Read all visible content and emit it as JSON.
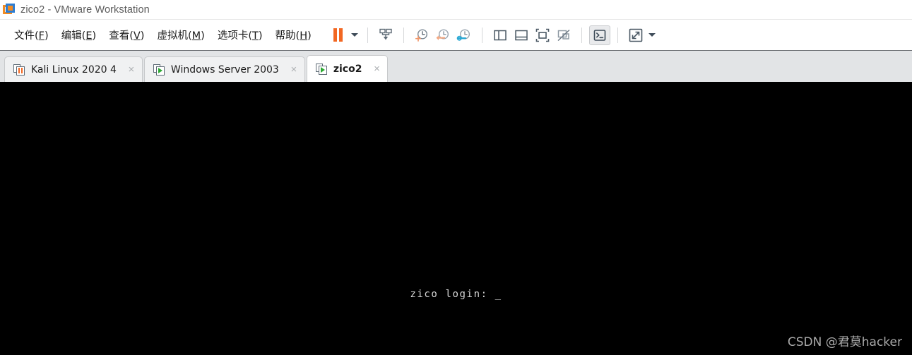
{
  "window": {
    "title": "zico2 - VMware Workstation",
    "logo_icon": "vmware-logo-icon"
  },
  "menubar": {
    "items": [
      {
        "label": "文件(F)",
        "name": "menu-file",
        "pre": "文件(",
        "key": "F",
        "post": ")"
      },
      {
        "label": "编辑(E)",
        "name": "menu-edit",
        "pre": "编辑(",
        "key": "E",
        "post": ")"
      },
      {
        "label": "查看(V)",
        "name": "menu-view",
        "pre": "查看(",
        "key": "V",
        "post": ")"
      },
      {
        "label": "虚拟机(M)",
        "name": "menu-vm",
        "pre": "虚拟机(",
        "key": "M",
        "post": ")"
      },
      {
        "label": "选项卡(T)",
        "name": "menu-tabs",
        "pre": "选项卡(",
        "key": "T",
        "post": ")"
      },
      {
        "label": "帮助(H)",
        "name": "menu-help",
        "pre": "帮助(",
        "key": "H",
        "post": ")"
      }
    ]
  },
  "toolbar": {
    "buttons": [
      {
        "name": "suspend-button",
        "icon": "pause-icon",
        "state": "normal"
      },
      {
        "name": "power-dropdown",
        "icon": "chevron-down-icon",
        "state": "normal"
      },
      {
        "name": "send-ctrl-alt-del-button",
        "icon": "snapshot-down-icon",
        "state": "normal"
      },
      {
        "name": "take-snapshot-button",
        "icon": "clock-plus-icon",
        "state": "normal"
      },
      {
        "name": "revert-snapshot-button",
        "icon": "clock-back-icon",
        "state": "normal"
      },
      {
        "name": "snapshot-manager-button",
        "icon": "clock-wrench-icon",
        "state": "normal"
      },
      {
        "name": "show-sidebar-button",
        "icon": "split-vertical-icon",
        "state": "normal"
      },
      {
        "name": "show-thumbnail-bar-button",
        "icon": "split-horizontal-icon",
        "state": "normal"
      },
      {
        "name": "full-screen-button",
        "icon": "expand-frame-icon",
        "state": "normal"
      },
      {
        "name": "unity-mode-button",
        "icon": "unity-off-icon",
        "state": "normal"
      },
      {
        "name": "console-view-button",
        "icon": "terminal-icon",
        "state": "active"
      },
      {
        "name": "stretch-guest-button",
        "icon": "fullscreen-arrows-icon",
        "state": "normal"
      },
      {
        "name": "stretch-dropdown",
        "icon": "chevron-down-icon",
        "state": "normal"
      }
    ]
  },
  "tabs": [
    {
      "name": "tab-kali-linux-2020-4",
      "label": "Kali Linux 2020 4",
      "state": "suspended",
      "icon": "vm-suspended-icon",
      "active": false,
      "close_glyph": "×"
    },
    {
      "name": "tab-windows-server-2003",
      "label": "Windows Server 2003",
      "state": "running",
      "icon": "vm-running-icon",
      "active": false,
      "close_glyph": "×"
    },
    {
      "name": "tab-zico2",
      "label": "zico2",
      "state": "running",
      "icon": "vm-running-icon",
      "active": true,
      "close_glyph": "×"
    }
  ],
  "vm_screen": {
    "console_text": "zico login: _",
    "background_color": "#000000",
    "text_color": "#d8d8d8"
  },
  "watermark": {
    "text": "CSDN @君莫hacker"
  },
  "colors": {
    "accent_orange": "#f26722",
    "accent_blue": "#2d7dd2",
    "running_green": "#2ba832",
    "tabstrip_bg": "#e2e4e6",
    "icon_slate": "#5d6a75"
  }
}
